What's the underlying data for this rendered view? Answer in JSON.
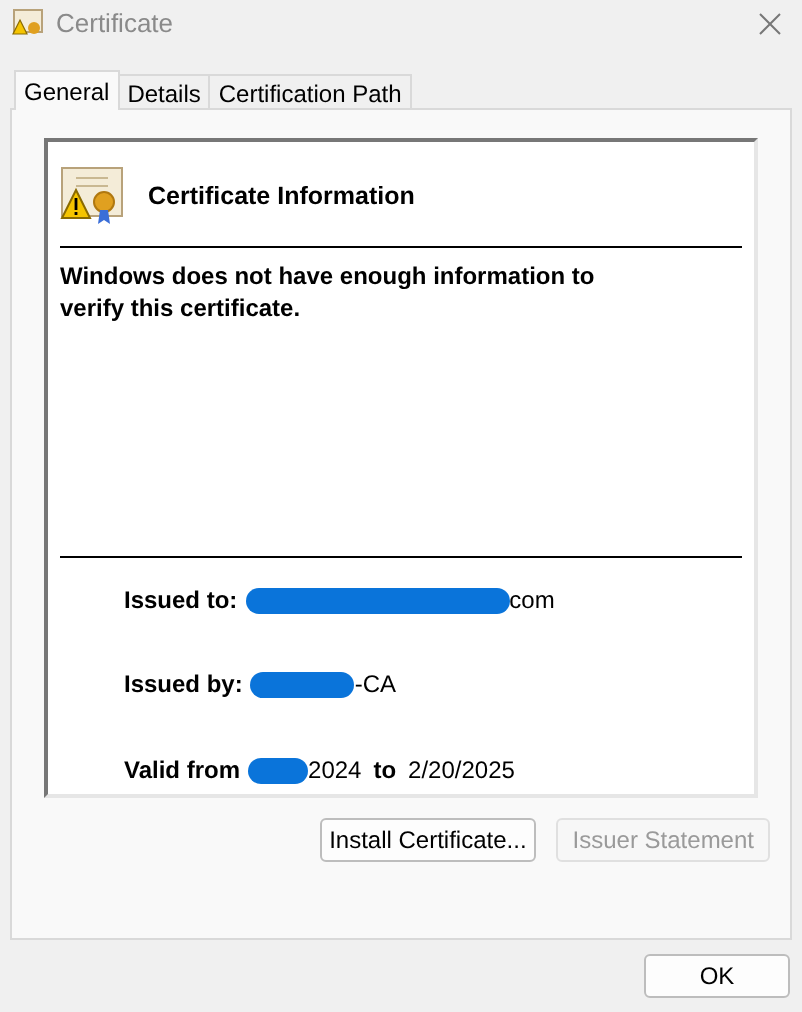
{
  "window": {
    "title": "Certificate"
  },
  "tabs": [
    {
      "label": "General",
      "selected": true
    },
    {
      "label": "Details",
      "selected": false
    },
    {
      "label": "Certification Path",
      "selected": false
    }
  ],
  "info": {
    "heading": "Certificate Information",
    "message": "Windows does not have enough information to verify this certificate."
  },
  "fields": [
    {
      "label": "Issued to:",
      "value": "com",
      "redacted": true
    },
    {
      "label": "Issued by:",
      "value": "-CA",
      "redacted": true
    }
  ],
  "validity": {
    "label": "Valid from",
    "from": "2024",
    "from_redacted": true,
    "to_label": "to",
    "to": "2/20/2025"
  },
  "buttons": [
    {
      "label": "Install Certificate...",
      "disabled": false
    },
    {
      "label": "Issuer Statement",
      "disabled": true
    }
  ],
  "footer": {
    "ok": "OK"
  }
}
